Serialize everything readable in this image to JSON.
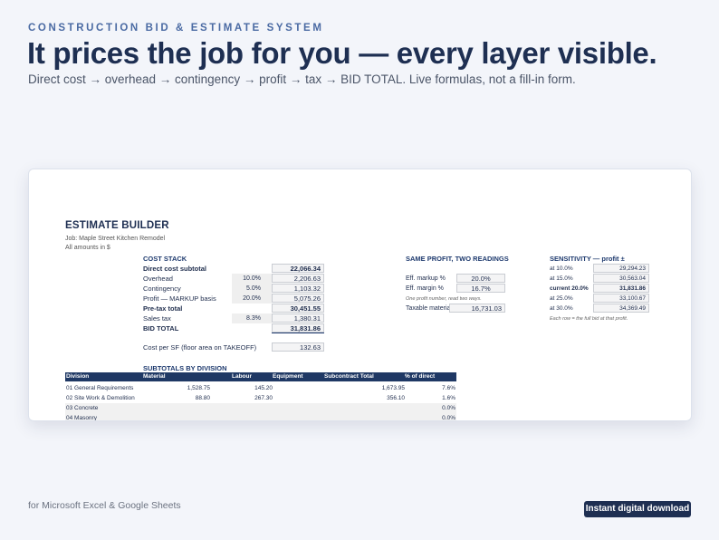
{
  "hero": {
    "eyebrow": "CONSTRUCTION BID & ESTIMATE SYSTEM",
    "headline": "It prices the job for you — every layer visible.",
    "subhead": "Direct cost → overhead → contingency → profit → tax → BID TOTAL. Live formulas, not a fill-in form."
  },
  "sheet": {
    "title": "ESTIMATE BUILDER",
    "job": "Job: Maple Street Kitchen Remodel",
    "amounts": "All amounts in $",
    "cost_stack": {
      "heading": "COST STACK",
      "rows": [
        {
          "label": "Direct cost subtotal",
          "pct": "",
          "value": "22,066.34",
          "bold": true
        },
        {
          "label": "Overhead",
          "pct": "10.0%",
          "value": "2,206.63",
          "bold": false
        },
        {
          "label": "Contingency",
          "pct": "5.0%",
          "value": "1,103.32",
          "bold": false
        },
        {
          "label": "Profit — MARKUP basis",
          "pct": "20.0%",
          "value": "5,075.26",
          "bold": false
        },
        {
          "label": "Pre-tax total",
          "pct": "",
          "value": "30,451.55",
          "bold": true
        },
        {
          "label": "Sales tax",
          "pct": "8.3%",
          "value": "1,380.31",
          "bold": false
        },
        {
          "label": "BID TOTAL",
          "pct": "",
          "value": "31,831.86",
          "bold": true
        }
      ],
      "cost_per_sf_label": "Cost per SF (floor area on TAKEOFF)",
      "cost_per_sf_value": "132.63"
    },
    "same_profit": {
      "heading": "SAME PROFIT, TWO READINGS",
      "markup_label": "Eff. markup %",
      "markup_value": "20.0%",
      "margin_label": "Eff. margin %",
      "margin_value": "16.7%",
      "note": "One profit number, read two ways.",
      "taxable_label": "Taxable materials",
      "taxable_value": "16,731.03"
    },
    "sensitivity": {
      "heading": "SENSITIVITY — profit ±",
      "rows": [
        {
          "label": "at  10.0%",
          "value": "29,294.23",
          "bold": false
        },
        {
          "label": "at  15.0%",
          "value": "30,563.04",
          "bold": false
        },
        {
          "label": "current  20.0%",
          "value": "31,831.86",
          "bold": true
        },
        {
          "label": "at  25.0%",
          "value": "33,100.67",
          "bold": false
        },
        {
          "label": "at  30.0%",
          "value": "34,369.49",
          "bold": false
        }
      ],
      "note": "Each row = the full bid at that profit."
    },
    "subtotals": {
      "heading": "SUBTOTALS BY DIVISION",
      "columns": [
        "Division",
        "Material",
        "Labour",
        "Equipment",
        "Subcontract Total",
        "% of direct"
      ],
      "rows": [
        {
          "division": "01 General Requirements",
          "material": "1,528.75",
          "labour": "145.20",
          "total": "1,673.95",
          "pct": "7.6%"
        },
        {
          "division": "02 Site Work & Demolition",
          "material": "88.80",
          "labour": "267.30",
          "total": "356.10",
          "pct": "1.6%"
        },
        {
          "division": "03 Concrete",
          "material": "",
          "labour": "",
          "total": "",
          "pct": "0.0%"
        },
        {
          "division": "04 Masonry",
          "material": "",
          "labour": "",
          "total": "",
          "pct": "0.0%"
        }
      ]
    }
  },
  "footer": {
    "platforms": "for Microsoft Excel & Google Sheets",
    "badge": "Instant digital download"
  }
}
